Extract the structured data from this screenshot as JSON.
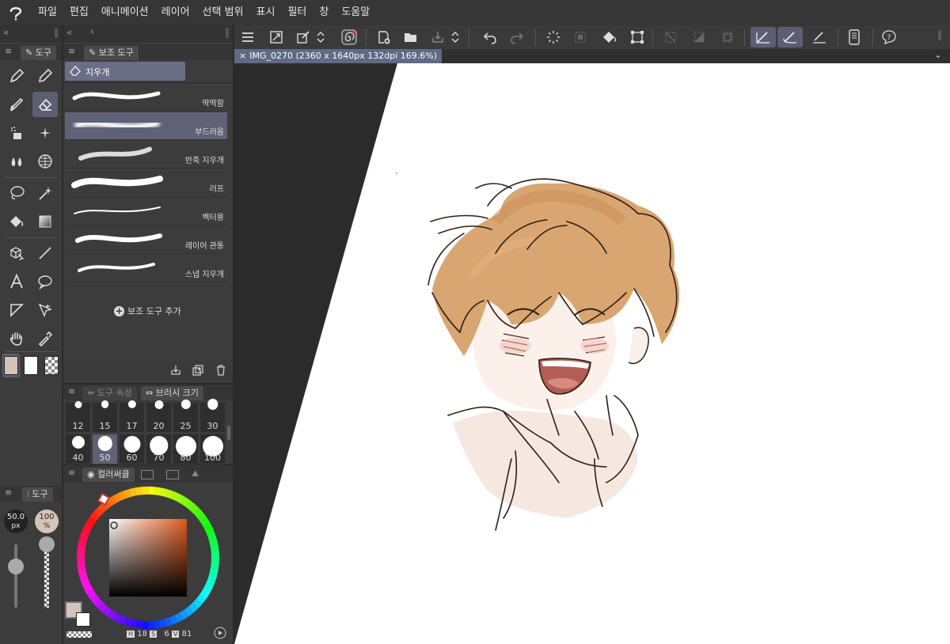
{
  "menu": [
    "파일",
    "편집",
    "애니메이션",
    "레이어",
    "선택 범위",
    "표시",
    "필터",
    "창",
    "도움말"
  ],
  "tool_panel": {
    "tab_label": "도구"
  },
  "subtool_panel": {
    "tab_label": "보조 도구",
    "group_label": "지우개",
    "brushes": [
      {
        "label": "딱딱함"
      },
      {
        "label": "부드러움",
        "selected": true
      },
      {
        "label": "반죽 지우개"
      },
      {
        "label": "러프"
      },
      {
        "label": "벡터용"
      },
      {
        "label": "레이어 관통"
      },
      {
        "label": "스냅 지우개"
      }
    ],
    "add_label": "보조 도구 추가"
  },
  "brush_size_panel": {
    "tab1": "도구 속성",
    "tab2": "브러시 크기",
    "sizes": [
      "12",
      "15",
      "17",
      "20",
      "25",
      "30",
      "40",
      "50",
      "60",
      "70",
      "80",
      "100"
    ],
    "selected": "50"
  },
  "tool_property": {
    "tab_label": "도구",
    "size_value": "50.0",
    "size_unit": "px",
    "opacity_value": "100",
    "opacity_unit": "%"
  },
  "color_panel": {
    "tab_label": "컬러써클",
    "h_label": "H",
    "h_value": "18",
    "s_label": "S",
    "s_value": "6",
    "v_label": "V",
    "v_value": "81",
    "main_color": "#d6c4b6",
    "sub_color": "#ffffff"
  },
  "document": {
    "tab_title": "IMG_0270 (2360 x 1640px 132dpi 169.6%)"
  },
  "colors": {
    "accent": "#5b5f73",
    "panel": "#3c3c3c",
    "doc_tab": "#5d6b85"
  }
}
